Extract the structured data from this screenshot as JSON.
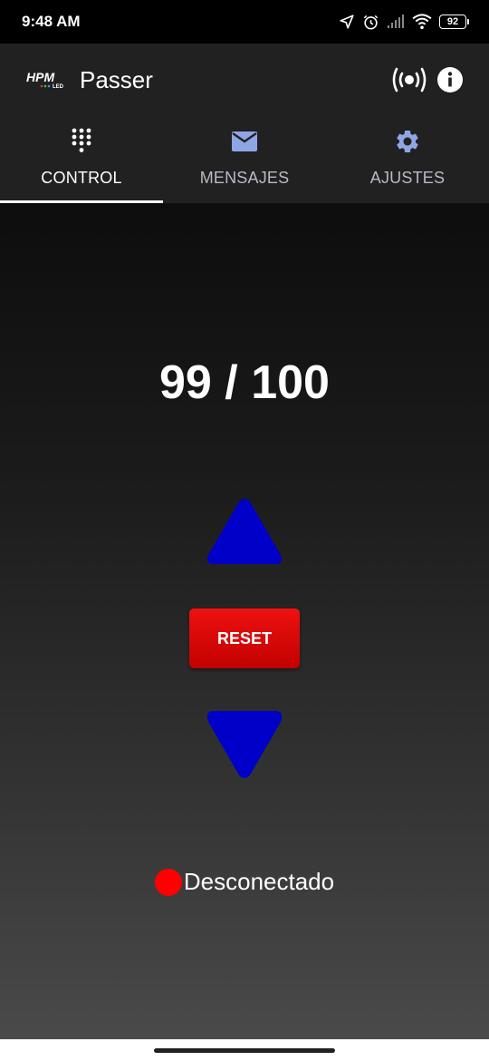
{
  "status_bar": {
    "time": "9:48 AM",
    "icons": [
      "location-icon",
      "alarm-icon",
      "signal-icon",
      "wifi-icon",
      "battery-icon"
    ],
    "battery_level": "92"
  },
  "app_bar": {
    "logo_text": "HPM",
    "logo_subtext": "LED",
    "title": "Passer",
    "actions": [
      {
        "name": "broadcast-icon"
      },
      {
        "name": "info-icon"
      }
    ]
  },
  "tabs": [
    {
      "label": "CONTROL",
      "icon": "dialpad-icon",
      "active": true
    },
    {
      "label": "MENSAJES",
      "icon": "mail-icon",
      "active": false
    },
    {
      "label": "AJUSTES",
      "icon": "gear-icon",
      "active": false
    }
  ],
  "control": {
    "counter_current": "99",
    "counter_separator": "/",
    "counter_total": "100",
    "counter_text": "99 / 100",
    "reset_label": "RESET",
    "connection_status": "Desconectado",
    "colors": {
      "arrow": "#0000c8",
      "reset": "#e00000",
      "status_disconnected": "#ff0000",
      "tab_icon_inactive": "#8fa6e6"
    }
  }
}
